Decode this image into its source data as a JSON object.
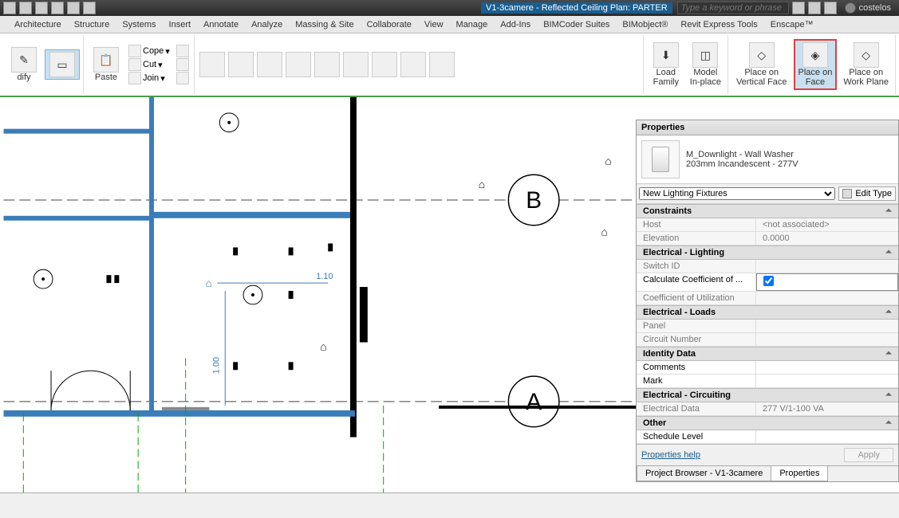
{
  "title": {
    "doc": "V1-3camere - Reflected Ceiling Plan: PARTER",
    "search_placeholder": "Type a keyword or phrase",
    "user": "costelos"
  },
  "menu": [
    "Architecture",
    "Structure",
    "Systems",
    "Insert",
    "Annotate",
    "Analyze",
    "Massing & Site",
    "Collaborate",
    "View",
    "Manage",
    "Add-Ins",
    "BIMCoder Suites",
    "BIMobject®",
    "Revit Express Tools",
    "Enscape™"
  ],
  "ribbon": {
    "modify": "dify",
    "paste": "Paste",
    "cope": "Cope",
    "cut": "Cut",
    "join": "Join",
    "load_family": "Load\nFamily",
    "model_inplace": "Model\nIn-place",
    "place_vface": "Place on\nVertical Face",
    "place_face": "Place on\nFace",
    "place_wplane": "Place on\nWork Plane"
  },
  "panel": {
    "title": "Properties",
    "family": "M_Downlight - Wall Washer",
    "type": "203mm Incandescent - 277V",
    "selector": "New Lighting Fixtures",
    "edit_type": "Edit Type",
    "sections": {
      "constraints": "Constraints",
      "elec_light": "Electrical - Lighting",
      "elec_loads": "Electrical - Loads",
      "identity": "Identity Data",
      "elec_circ": "Electrical - Circuiting",
      "other": "Other"
    },
    "props": {
      "host_k": "Host",
      "host_v": "<not associated>",
      "elev_k": "Elevation",
      "elev_v": "0.0000",
      "switch_k": "Switch ID",
      "switch_v": "",
      "calc_k": "Calculate Coefficient of ...",
      "coef_k": "Coefficient of Utilization",
      "coef_v": "",
      "panel_k": "Panel",
      "panel_v": "",
      "circuit_k": "Circuit Number",
      "circuit_v": "",
      "comments_k": "Comments",
      "comments_v": "",
      "mark_k": "Mark",
      "mark_v": "",
      "elecdata_k": "Electrical Data",
      "elecdata_v": "277 V/1-100 VA",
      "sched_k": "Schedule Level",
      "sched_v": ""
    },
    "help": "Properties help",
    "apply": "Apply",
    "tabs": [
      "Project Browser - V1-3camere",
      "Properties"
    ]
  },
  "drawing": {
    "grid_a": "A",
    "grid_b": "B",
    "dim1": "1.10",
    "dim2": "1.00"
  }
}
